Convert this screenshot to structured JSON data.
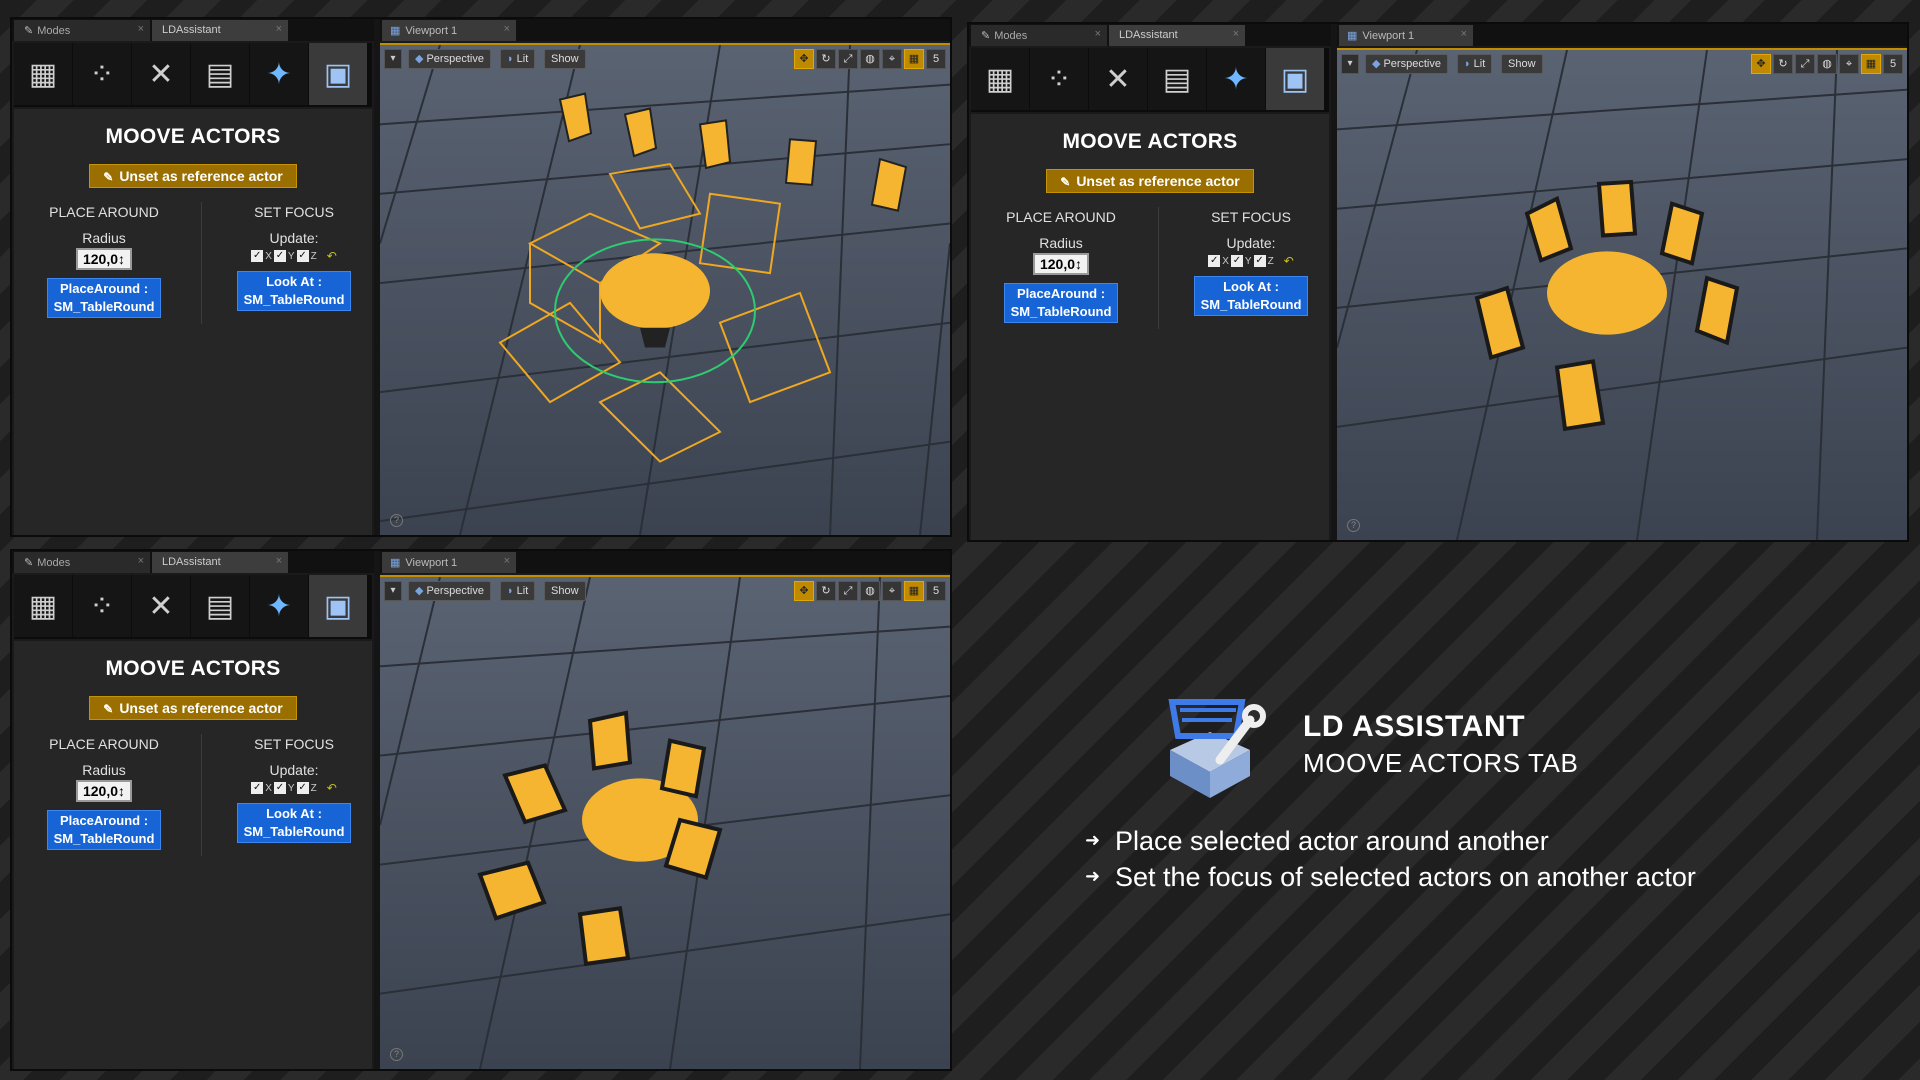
{
  "panel": {
    "tabs": {
      "modes": "Modes",
      "ld": "LDAssistant"
    },
    "title": "MOOVE ACTORS",
    "reference_button": "Unset as  reference actor",
    "place_around": "PLACE AROUND",
    "radius_label": "Radius",
    "radius_value": "120,0",
    "set_focus": "SET FOCUS",
    "update_label": "Update:",
    "axis_x": "X",
    "axis_y": "Y",
    "axis_z": "Z",
    "place_button_line1": "PlaceAround :",
    "place_button_line2": "SM_TableRound",
    "look_button_line1": "Look At :",
    "look_button_line2": "SM_TableRound"
  },
  "viewport": {
    "tab": "Viewport 1",
    "perspective": "Perspective",
    "lit": "Lit",
    "show": "Show",
    "grid_value": "5"
  },
  "promo": {
    "title": "LD ASSISTANT",
    "subtitle": "MOOVE ACTORS TAB",
    "bullets": [
      "Place selected actor around another",
      "Set the focus of selected actors on another actor"
    ]
  },
  "colors": {
    "accent_gold": "#c38d00",
    "button_blue": "#1664d6",
    "chair_yellow": "#f5b530"
  },
  "icons": [
    "place-mode-icon",
    "paint-mode-icon",
    "wrench-icon",
    "notes-icon",
    "foliage-icon",
    "ld-assistant-icon",
    "help-icon"
  ]
}
